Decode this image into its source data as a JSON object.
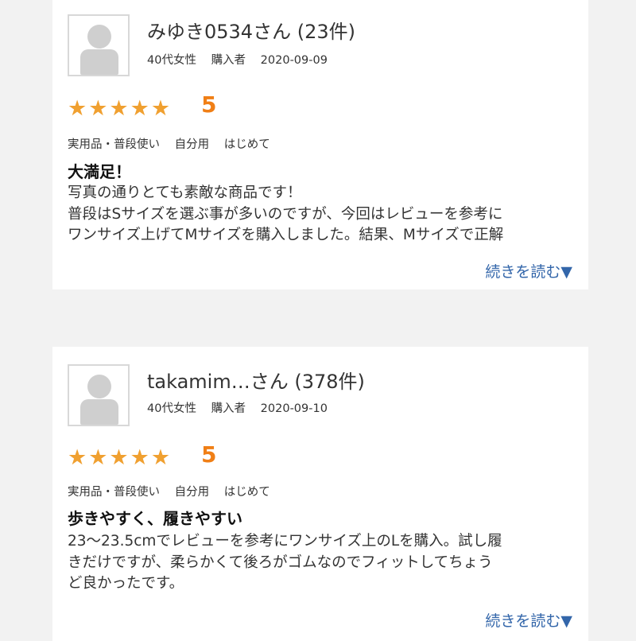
{
  "reviews": [
    {
      "username": "みゆき0534さん (23件)",
      "age_gender": "40代女性",
      "buyer": "購入者",
      "date": "2020-09-09",
      "stars": "★★★★★",
      "score": "5",
      "tags": [
        "実用品・普段使い",
        "自分用",
        "はじめて"
      ],
      "title": "大満足！",
      "body_lines": [
        "写真の通りとても素敵な商品です！",
        "普段はSサイズを選ぶ事が多いのですが、今回はレビューを参考に",
        "ワンサイズ上げてMサイズを購入しました。結果、Mサイズで正解"
      ],
      "read_more": "続きを読む▼"
    },
    {
      "username": "takamim…さん (378件)",
      "age_gender": "40代女性",
      "buyer": "購入者",
      "date": "2020-09-10",
      "stars": "★★★★★",
      "score": "5",
      "tags": [
        "実用品・普段使い",
        "自分用",
        "はじめて"
      ],
      "title": "歩きやすく、履きやすい",
      "body_lines": [
        "23〜23.5cmでレビューを参考にワンサイズ上のLを購入。試し履",
        "きだけですが、柔らかくて後ろがゴムなのでフィットしてちょう",
        "ど良かったです。"
      ],
      "read_more": "続きを読む▼"
    }
  ]
}
